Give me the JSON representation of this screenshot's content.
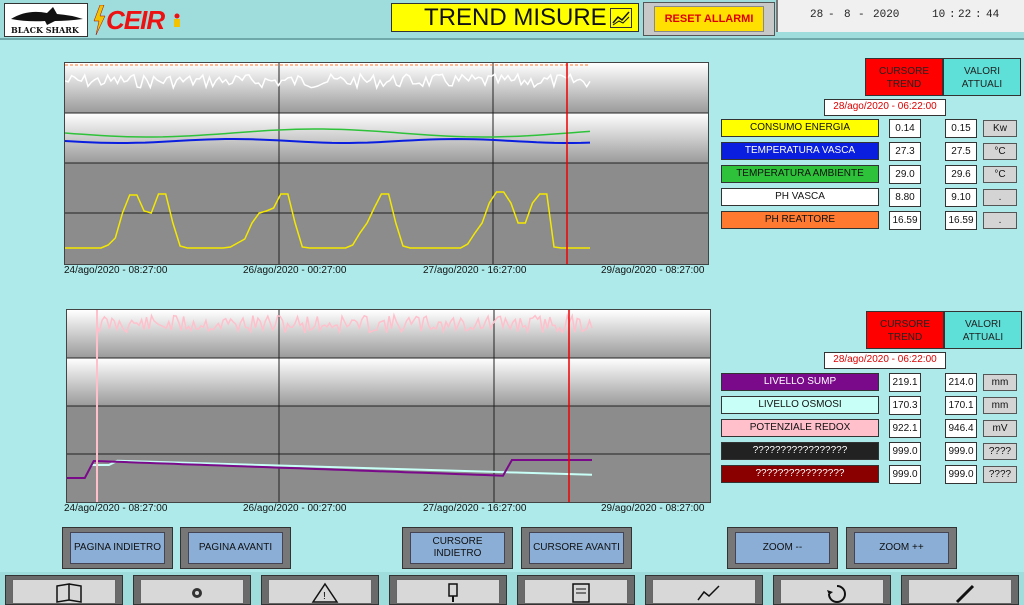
{
  "header": {
    "logo_left": "BLACK SHARK",
    "logo_right": "CEIR",
    "title": "TREND MISURE",
    "title_icon": "trend-chart-icon",
    "reset_label": "RESET ALLARMI",
    "date_day": "28",
    "date_month": "8",
    "date_year": "2020",
    "time_h": "10",
    "time_m": "22",
    "time_s": "44"
  },
  "panel1": {
    "cursore_header": "CURSORE TREND",
    "valori_header": "VALORI ATTUALI",
    "cursor_timestamp": "28/ago/2020 - 06:22:00",
    "rows": [
      {
        "label": "CONSUMO ENERGIA",
        "color": "#ffff00",
        "text_color": "#111111",
        "cursor_value": "0.14",
        "current_value": "0.15",
        "unit": "Kw"
      },
      {
        "label": "TEMPERATURA VASCA",
        "color": "#0a1ee0",
        "text_color": "#ffffff",
        "cursor_value": "27.3",
        "current_value": "27.5",
        "unit": "°C"
      },
      {
        "label": "TEMPERATURA AMBIENTE",
        "color": "#2ec23a",
        "text_color": "#111111",
        "cursor_value": "29.0",
        "current_value": "29.6",
        "unit": "°C"
      },
      {
        "label": "PH VASCA",
        "color": "#ffffff",
        "text_color": "#111111",
        "cursor_value": "8.80",
        "current_value": "9.10",
        "unit": "."
      },
      {
        "label": "PH REATTORE",
        "color": "#ff7a30",
        "text_color": "#111111",
        "cursor_value": "16.59",
        "current_value": "16.59",
        "unit": "."
      }
    ]
  },
  "panel2": {
    "cursore_header": "CURSORE TREND",
    "valori_header": "VALORI ATTUALI",
    "cursor_timestamp": "28/ago/2020 - 06:22:00",
    "rows": [
      {
        "label": "LIVELLO SUMP",
        "color": "#7a0a8a",
        "text_color": "#ffffff",
        "cursor_value": "219.1",
        "current_value": "214.0",
        "unit": "mm"
      },
      {
        "label": "LIVELLO OSMOSI",
        "color": "#c8fff6",
        "text_color": "#111111",
        "cursor_value": "170.3",
        "current_value": "170.1",
        "unit": "mm"
      },
      {
        "label": "POTENZIALE REDOX",
        "color": "#ffc0cc",
        "text_color": "#111111",
        "cursor_value": "922.1",
        "current_value": "946.4",
        "unit": "mV"
      },
      {
        "label": "?????????????????",
        "color": "#222222",
        "text_color": "#ffffff",
        "cursor_value": "999.0",
        "current_value": "999.0",
        "unit": "????"
      },
      {
        "label": "????????????????",
        "color": "#8a0000",
        "text_color": "#ffffff",
        "cursor_value": "999.0",
        "current_value": "999.0",
        "unit": "????"
      }
    ]
  },
  "chart1": {
    "x_ticks": [
      "24/ago/2020 - 08:27:00",
      "26/ago/2020 - 00:27:00",
      "27/ago/2020 - 16:27:00",
      "29/ago/2020 - 08:27:00"
    ]
  },
  "chart2": {
    "x_ticks": [
      "24/ago/2020 - 08:27:00",
      "26/ago/2020 - 00:27:00",
      "27/ago/2020 - 16:27:00",
      "29/ago/2020 - 08:27:00"
    ]
  },
  "buttons": {
    "pagina_indietro": "PAGINA INDIETRO",
    "pagina_avanti": "PAGINA AVANTI",
    "cursore_indietro": "CURSORE INDIETRO",
    "cursore_avanti": "CURSORE AVANTI",
    "zoom_minus": "ZOOM --",
    "zoom_plus": "ZOOM ++"
  },
  "bottom_nav": [
    "book-icon",
    "gear-icon",
    "warning-icon",
    "hand-pointer-icon",
    "report-icon",
    "trend-chart-icon",
    "recycle-icon",
    "pencil-icon"
  ]
}
